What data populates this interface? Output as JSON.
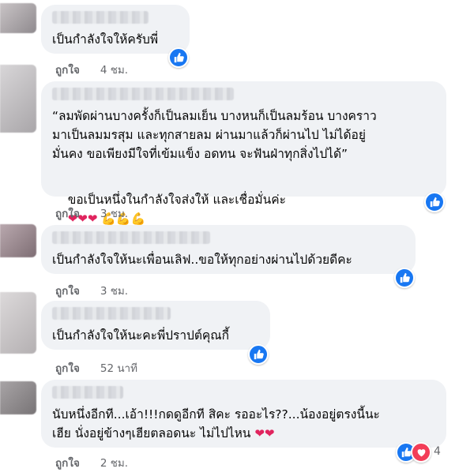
{
  "comments": [
    {
      "text": "เป็นกำลังใจให้ครับพี่",
      "like_label": "ถูกใจ",
      "time": "4 ชม."
    },
    {
      "text": "“ลมพัดผ่านบางครั้งก็เป็นลมเย็น บางหนก็เป็นลมร้อน บางคราว\nมาเป็นลมมรสุม และทุกสายลม ผ่านมาแล้วก็ผ่านไป ไม่ได้อยู่\nมั่นคง ขอเพียงมีใจที่เข้มแข็ง อดทน จะฟันฝ่าทุกสิ่งไปได้”",
      "text2": "ขอเป็นหนึ่งในกำลังใจส่งให้ และเชื่อมั่นค่ะ",
      "emojis": "❤❤❤ 💪💪💪",
      "like_label": "ถูกใจ",
      "time": "3 ชม."
    },
    {
      "text": "เป็นกำลังใจให้นะเพื่อนเลิฟ..ขอให้ทุกอย่างผ่านไปด้วยดีคะ",
      "like_label": "ถูกใจ",
      "time": "3 ชม."
    },
    {
      "text": "เป็นกำลังใจให้นะคะพี่ปราปต์คุณกี้",
      "like_label": "ถูกใจ",
      "time": "52 นาที"
    },
    {
      "text": "นับหนึ่งอีกที...เอ้า!!!กดดูอีกที สิคะ รออะไร??...น้องอยู่ตรงนี้นะ\nเฮีย นั่งอยู่ข้างๆเฮียตลอดนะ ไม่ไปไหน",
      "emojis": "❤❤",
      "like_label": "ถูกใจ",
      "time": "2 ชม.",
      "reaction_count": "4"
    }
  ],
  "colors": {
    "like_blue": "#1877f2",
    "heart_red": "#f33e58",
    "bubble": "#f0f2f5",
    "meta": "#65676b"
  },
  "icons": {
    "like": "thumbs-up-icon",
    "love": "heart-icon"
  }
}
